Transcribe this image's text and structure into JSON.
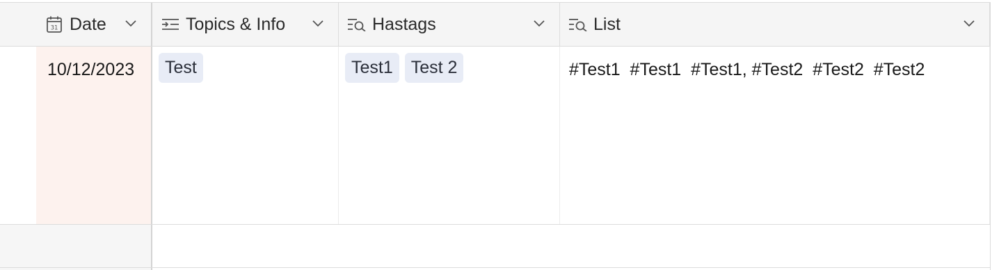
{
  "columns": {
    "date": {
      "label": "Date",
      "icon": "calendar-icon"
    },
    "topics": {
      "label": "Topics & Info",
      "icon": "text-indent-icon"
    },
    "hashtags": {
      "label": "Hastags",
      "icon": "lookup-icon"
    },
    "list": {
      "label": "List",
      "icon": "lookup-icon"
    }
  },
  "rows": [
    {
      "date": "10/12/2023",
      "topics": [
        "Test"
      ],
      "hashtags": [
        "Test1",
        "Test 2"
      ],
      "list": "#Test1  #Test1  #Test1, #Test2  #Test2  #Test2"
    }
  ],
  "colors": {
    "date_cell_bg": "#fdf2ee",
    "tag_bg": "#e8ecf6",
    "header_bg": "#f5f5f5"
  }
}
